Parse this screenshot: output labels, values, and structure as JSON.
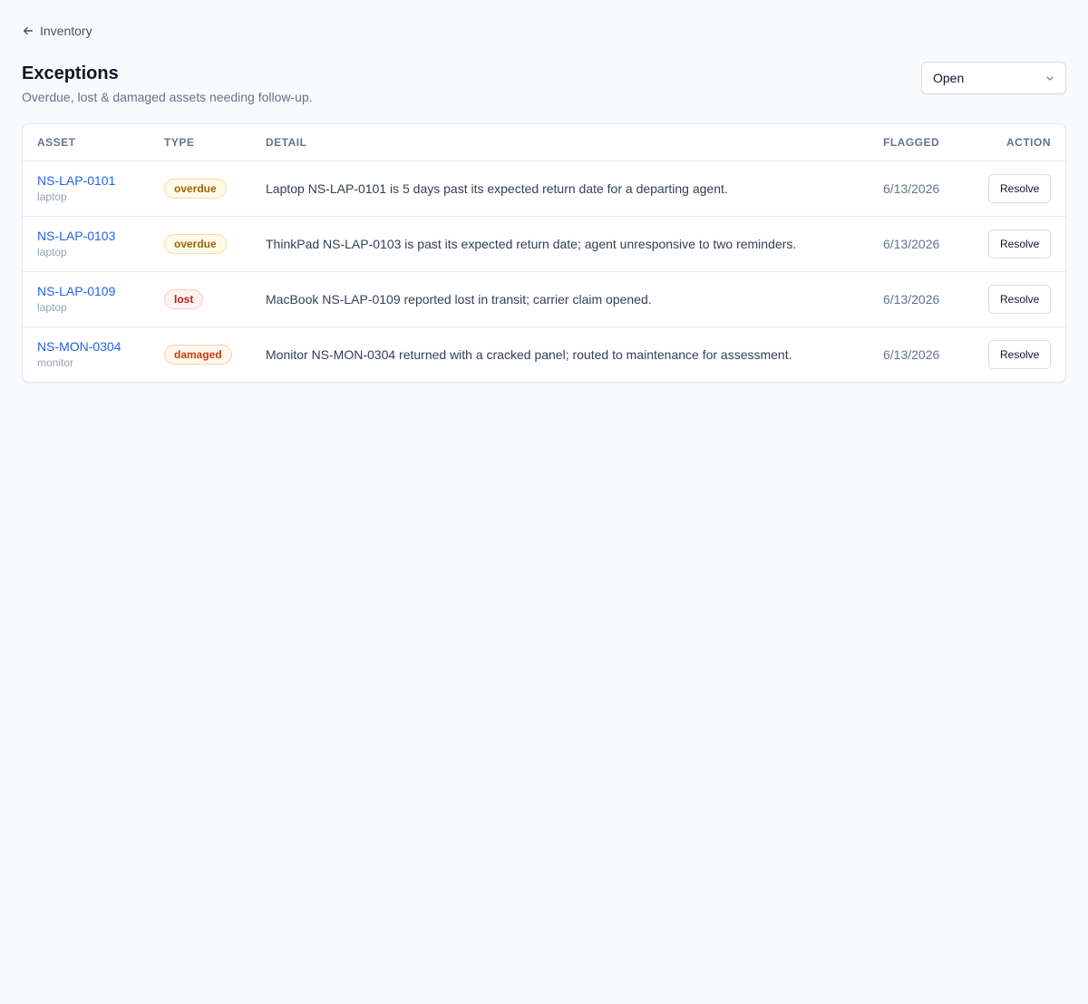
{
  "nav": {
    "back_label": "Inventory"
  },
  "header": {
    "title": "Exceptions",
    "subtitle": "Overdue, lost & damaged assets needing follow-up.",
    "status_filter": "Open"
  },
  "table": {
    "columns": {
      "asset": "Asset",
      "type": "Type",
      "detail": "Detail",
      "flagged": "Flagged",
      "action": "Action"
    },
    "rows": [
      {
        "asset_id": "NS-LAP-0101",
        "asset_kind": "laptop",
        "type": "overdue",
        "detail": "Laptop NS-LAP-0101 is 5 days past its expected return date for a departing agent.",
        "flagged": "6/13/2026",
        "action": "Resolve"
      },
      {
        "asset_id": "NS-LAP-0103",
        "asset_kind": "laptop",
        "type": "overdue",
        "detail": "ThinkPad NS-LAP-0103 is past its expected return date; agent unresponsive to two reminders.",
        "flagged": "6/13/2026",
        "action": "Resolve"
      },
      {
        "asset_id": "NS-LAP-0109",
        "asset_kind": "laptop",
        "type": "lost",
        "detail": "MacBook NS-LAP-0109 reported lost in transit; carrier claim opened.",
        "flagged": "6/13/2026",
        "action": "Resolve"
      },
      {
        "asset_id": "NS-MON-0304",
        "asset_kind": "monitor",
        "type": "damaged",
        "detail": "Monitor NS-MON-0304 returned with a cracked panel; routed to maintenance for assessment.",
        "flagged": "6/13/2026",
        "action": "Resolve"
      }
    ]
  },
  "colors": {
    "link": "#2563eb",
    "overdue": "#a16207",
    "lost": "#b91c1c",
    "damaged": "#c2410c"
  },
  "icons": {
    "back": "arrow-left-icon",
    "select": "chevron-down-icon"
  }
}
